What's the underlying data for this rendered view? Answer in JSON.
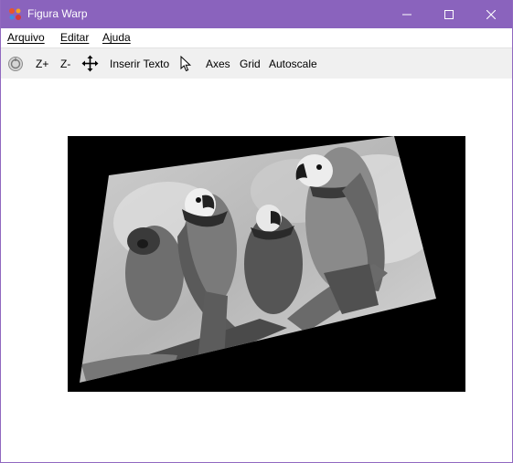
{
  "window": {
    "title": "Figura Warp",
    "icon": "app-logo-icon",
    "controls": [
      "minimize-icon",
      "maximize-icon",
      "close-icon"
    ],
    "accent_color": "#8a63bd"
  },
  "menu": {
    "items": [
      {
        "label": "Arquivo"
      },
      {
        "label": "Editar"
      },
      {
        "label": "Ajuda"
      }
    ]
  },
  "toolbar": {
    "reset_icon": "reset-view-icon",
    "zoom_in_label": "Z+",
    "zoom_out_label": "Z-",
    "pan_icon": "pan-move-icon",
    "insert_text_label": "Inserir Texto",
    "pointer_icon": "pointer-icon",
    "axes_label": "Axes",
    "grid_label": "Grid",
    "autoscale_label": "Autoscale"
  },
  "figure": {
    "content": "warped-grayscale-photo",
    "background": "#000000"
  }
}
